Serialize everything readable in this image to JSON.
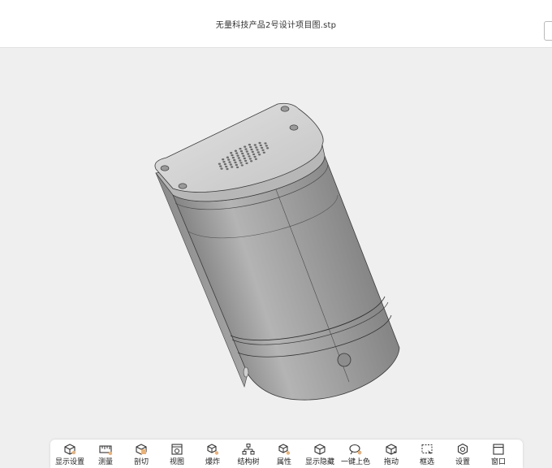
{
  "window": {
    "file_title": "无量科技产品2号设计项目图.stp"
  },
  "toolbar": {
    "items": [
      {
        "label": "显示设置",
        "icon": "display-settings-icon"
      },
      {
        "label": "测量",
        "icon": "measure-icon"
      },
      {
        "label": "剖切",
        "icon": "section-cut-icon"
      },
      {
        "label": "视图",
        "icon": "view-icon"
      },
      {
        "label": "爆炸",
        "icon": "explode-icon"
      },
      {
        "label": "结构树",
        "icon": "structure-tree-icon"
      },
      {
        "label": "属性",
        "icon": "properties-icon"
      },
      {
        "label": "显示隐藏",
        "icon": "show-hide-icon"
      },
      {
        "label": "一键上色",
        "icon": "one-click-color-icon"
      },
      {
        "label": "拖动",
        "icon": "drag-icon"
      },
      {
        "label": "框选",
        "icon": "box-select-icon"
      },
      {
        "label": "设置",
        "icon": "settings-icon"
      },
      {
        "label": "窗口",
        "icon": "window-icon"
      }
    ]
  },
  "colors": {
    "background": "#efefef",
    "model_body": "#9c9c9c",
    "model_top": "#d4d4d4",
    "accent": "#e8b27a"
  }
}
